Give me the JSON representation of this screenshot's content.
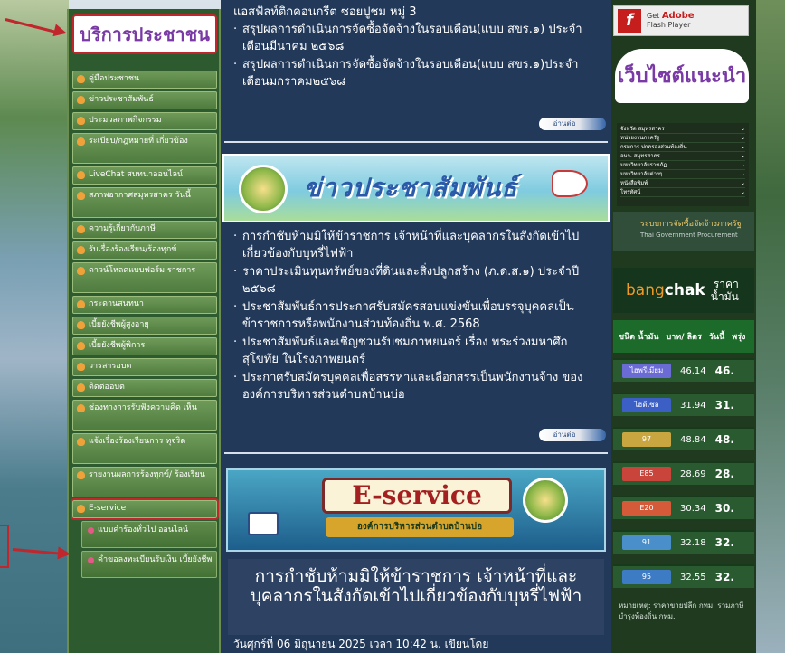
{
  "sidebar": {
    "title": "บริการประชาชน",
    "items": [
      {
        "label": "คู่มือประชาชน"
      },
      {
        "label": "ข่าวประชาสัมพันธ์"
      },
      {
        "label": "ประมวลภาพกิจกรรม"
      },
      {
        "label": "ระเบียบ/กฎหมายที่ เกี่ยวข้อง"
      },
      {
        "label": "LiveChat สนทนาออนไลน์"
      },
      {
        "label": "สภาพอากาศสมุทรสาคร วันนี้"
      },
      {
        "label": "ความรู้เกี่ยวกับภาษี"
      },
      {
        "label": "รับเรื่องร้องเรียน/ร้องทุกข์"
      },
      {
        "label": "ดาวน์โหลดแบบฟอร์ม ราชการ"
      },
      {
        "label": "กระดานสนทนา"
      },
      {
        "label": "เบี้ยยังชีพผู้สูงอายุ"
      },
      {
        "label": "เบี้ยยังชีพผู้พิการ"
      },
      {
        "label": "วารสารอบต"
      },
      {
        "label": "ติดต่ออบต"
      },
      {
        "label": "ช่องทางการรับฟังความคิด เห็น"
      },
      {
        "label": "แจ้งเรื่องร้องเรียนการ ทุจริต"
      },
      {
        "label": "รายงานผลการร้องทุกข์/ ร้องเรียน"
      },
      {
        "label": "E-service"
      }
    ],
    "sub_items": [
      {
        "label": "แบบคำร้องทั่วไป ออนไลน์"
      },
      {
        "label": "คำขอลงทะเบียนรับเงิน เบี้ยยังชีพ"
      }
    ]
  },
  "news_top": {
    "lead": "แอสฟัลท์ติกคอนกรีต ซอยปูชม หมู่ 3",
    "items": [
      "สรุปผลการดำเนินการจัดซื้อจัดจ้างในรอบเดือน(แบบ สขร.๑) ประจำเดือนมีนาคม ๒๕๖๘",
      "สรุปผลการดำเนินการจัดซื้อจัดจ้างในรอบเดือน(แบบ สขร.๑)ประจำเดือนมกราคม๒๕๖๘"
    ],
    "read_more": "อ่านต่อ"
  },
  "pr_banner": {
    "title": "ข่าวประชาสัมพันธ์"
  },
  "pr_news": {
    "items": [
      "การกำชับห้ามมิให้ข้าราชการ เจ้าหน้าที่และบุคลากรในสังกัดเข้าไปเกี่ยวข้องกับบุหรี่ไฟฟ้า",
      "ราคาประเมินทุนทรัพย์ของที่ดินและสิ่งปลูกสร้าง (ภ.ด.ส.๑) ประจำปี ๒๕๖๘",
      "ประชาสัมพันธ์การประกาศรับสมัครสอบแข่งขันเพื่อบรรจุบุคคลเป็นข้าราชการหรือพนักงานส่วนท้องถิ่น พ.ศ. 2568",
      "ประชาสัมพันธ์และเชิญชวนรับชมภาพยนตร์ เรื่อง พระร่วงมหาศึกสุโขทัย ในโรงภาพยนตร์",
      "ประกาศรับสมัครบุคคลเพื่อสรรหาและเลือกสรรเป็นพนักงานจ้าง ขององค์การบริหารส่วนตำบลบ้านบ่อ"
    ],
    "read_more": "อ่านต่อ"
  },
  "eservice": {
    "title": "E-service",
    "subtitle": "องค์การบริหารส่วนตำบลบ้านบ่อ"
  },
  "headline": {
    "text": "การกำชับห้ามมิให้ข้าราชการ เจ้าหน้าที่และบุคลากรในสังกัดเข้าไปเกี่ยวข้องกับบุหรี่ไฟฟ้า",
    "date": "วันศุกร์ที่ 06 มิถุนายน 2025 เวลา 10:42 น. เขียนโดย"
  },
  "right": {
    "flash": {
      "get": "Get",
      "brand": "Adobe",
      "product": "Flash Player"
    },
    "web_title": "เว็บไซต์แนะนำ",
    "web_links": [
      "จังหวัด สมุทรสาคร",
      "หน่วยงานภาครัฐ",
      "กรมการ ปกครองส่วนท้องถิ่น",
      "อบจ. สมุทรสาคร",
      "มหาวิทยาลัยราชภัฏ",
      "มหาวิทยาลัยต่างๆ",
      "หนังสือพิมพ์",
      "โทรทัศน์"
    ],
    "gov_proc": {
      "title": "ระบบการจัดซื้อจัดจ้างภาครัฐ",
      "subtitle": "Thai Government Procurement"
    },
    "bangchak": {
      "brand_a": "bang",
      "brand_b": "chak",
      "price_line1": "ราคา",
      "price_line2": "น้ำมัน"
    },
    "oil_head": {
      "type": "ชนิด น้ำมัน",
      "unit": "บาท/ ลิตร",
      "day": "วันนี้",
      "tomorrow": "พรุ่ง"
    },
    "oil_rows": [
      {
        "name": "ไฮพรีเมียม",
        "today": "46.14",
        "tomorrow": "46.",
        "color": "#6b6bd6"
      },
      {
        "name": "ไฮดีเซล",
        "today": "31.94",
        "tomorrow": "31.",
        "color": "#3b5fc4"
      },
      {
        "name": "97",
        "today": "48.84",
        "tomorrow": "48.",
        "color": "#c9a640"
      },
      {
        "name": "E85",
        "today": "28.69",
        "tomorrow": "28.",
        "color": "#c9443a"
      },
      {
        "name": "E20",
        "today": "30.34",
        "tomorrow": "30.",
        "color": "#d45a3a"
      },
      {
        "name": "91",
        "today": "32.18",
        "tomorrow": "32.",
        "color": "#4a8fc9"
      },
      {
        "name": "95",
        "today": "32.55",
        "tomorrow": "32.",
        "color": "#3d7bc4"
      }
    ],
    "oil_note": "หมายเหตุ: ราคาขายปลีก กทม. รวมภาษีบำรุงท้องถิ่น กทม."
  }
}
